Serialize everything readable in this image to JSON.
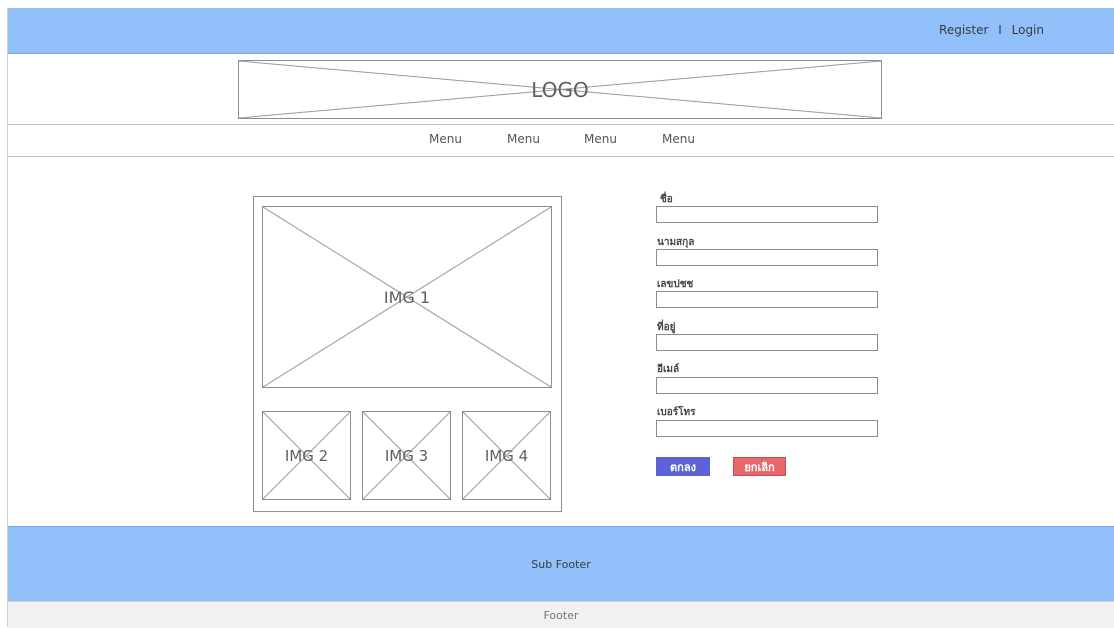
{
  "topbar": {
    "register_label": "Register",
    "separator": "I",
    "login_label": "Login",
    "background_color": "#92c0fb"
  },
  "header": {
    "logo_text": "LOGO"
  },
  "nav": {
    "items": [
      {
        "label": "Menu"
      },
      {
        "label": "Menu"
      },
      {
        "label": "Menu"
      },
      {
        "label": "Menu"
      }
    ]
  },
  "gallery": {
    "main_image_label": "IMG 1",
    "thumbnails": [
      {
        "label": "IMG 2"
      },
      {
        "label": "IMG 3"
      },
      {
        "label": "IMG 4"
      }
    ]
  },
  "form": {
    "fields": [
      {
        "label": "ชื่อ",
        "value": ""
      },
      {
        "label": "นามสกุล",
        "value": ""
      },
      {
        "label": "เลขปชช",
        "value": ""
      },
      {
        "label": "ที่อยู่",
        "value": ""
      },
      {
        "label": "อีเมล์",
        "value": ""
      },
      {
        "label": "เบอร์โทร",
        "value": ""
      }
    ],
    "submit_label": "ตกลง",
    "cancel_label": "ยกเลิก",
    "submit_color": "#5b63d6",
    "cancel_color": "#e8686b"
  },
  "subfooter": {
    "text": "Sub Footer"
  },
  "footer": {
    "text": "Footer"
  }
}
